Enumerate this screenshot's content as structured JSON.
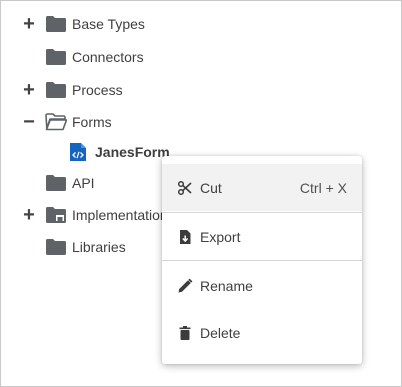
{
  "tree": {
    "items": [
      {
        "label": "Base Types",
        "expander": "+"
      },
      {
        "label": "Connectors",
        "expander": ""
      },
      {
        "label": "Process",
        "expander": "+"
      },
      {
        "label": "Forms",
        "expander": "−"
      },
      {
        "label": "JanesForm"
      },
      {
        "label": "API",
        "expander": ""
      },
      {
        "label": "Implementations",
        "expander": "+"
      },
      {
        "label": "Libraries",
        "expander": ""
      }
    ]
  },
  "context_menu": {
    "cut": {
      "label": "Cut",
      "shortcut": "Ctrl + X"
    },
    "export": {
      "label": "Export"
    },
    "rename": {
      "label": "Rename"
    },
    "delete": {
      "label": "Delete"
    }
  },
  "colors": {
    "folder": "#5f6368",
    "file_icon": "#1565c0",
    "menu_hover": "#f2f2f2"
  }
}
